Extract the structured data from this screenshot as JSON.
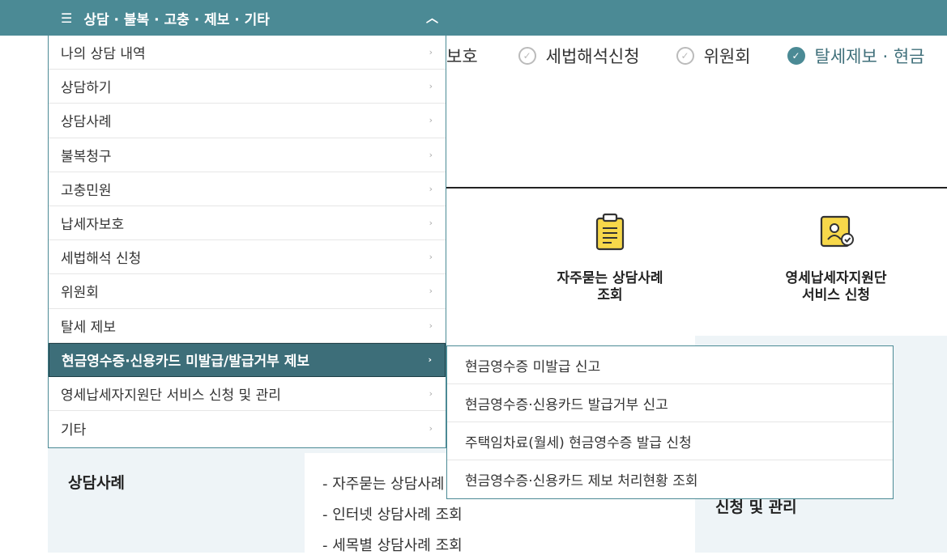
{
  "menu": {
    "title": "상담 · 불복 · 고충 · 제보 · 기타",
    "items": [
      {
        "label": "나의 상담 내역"
      },
      {
        "label": "상담하기"
      },
      {
        "label": "상담사례"
      },
      {
        "label": "불복청구"
      },
      {
        "label": "고충민원"
      },
      {
        "label": "납세자보호"
      },
      {
        "label": "세법해석 신청"
      },
      {
        "label": "위원회"
      },
      {
        "label": "탈세 제보"
      },
      {
        "label": "현금영수증·신용카드 미발급/발급거부 제보",
        "selected": true
      },
      {
        "label": "영세납세자지원단 서비스 신청 및 관리"
      },
      {
        "label": "기타"
      }
    ],
    "submenu": [
      {
        "label": "현금영수증 미발급 신고"
      },
      {
        "label": "현금영수증·신용카드 발급거부 신고"
      },
      {
        "label": "주택임차료(월세) 현금영수증 발급 신청"
      },
      {
        "label": "현금영수증·신용카드 제보 처리현황 조회"
      }
    ]
  },
  "subnav": {
    "partial": "보호",
    "items": [
      {
        "label": "세법해석신청",
        "active": false
      },
      {
        "label": "위원회",
        "active": false
      },
      {
        "label": "탈세제보 · 현금",
        "active": true
      }
    ]
  },
  "quick_links": [
    {
      "line1": "자주묻는 상담사례",
      "line2": "조회",
      "icon": "document-icon"
    },
    {
      "line1": "영세납세자지원단",
      "line2": "서비스 신청",
      "icon": "certificate-icon"
    }
  ],
  "section": {
    "title": "상담사례",
    "links": [
      "- 자주묻는 상담사례",
      "- 인터넷 상담사례 조회",
      "- 세목별 상담사례 조회"
    ],
    "right_title": "신청 및 관리"
  },
  "colors": {
    "accent": "#4b8a95",
    "selected": "#3d6e79",
    "background": "#eef4f7"
  }
}
